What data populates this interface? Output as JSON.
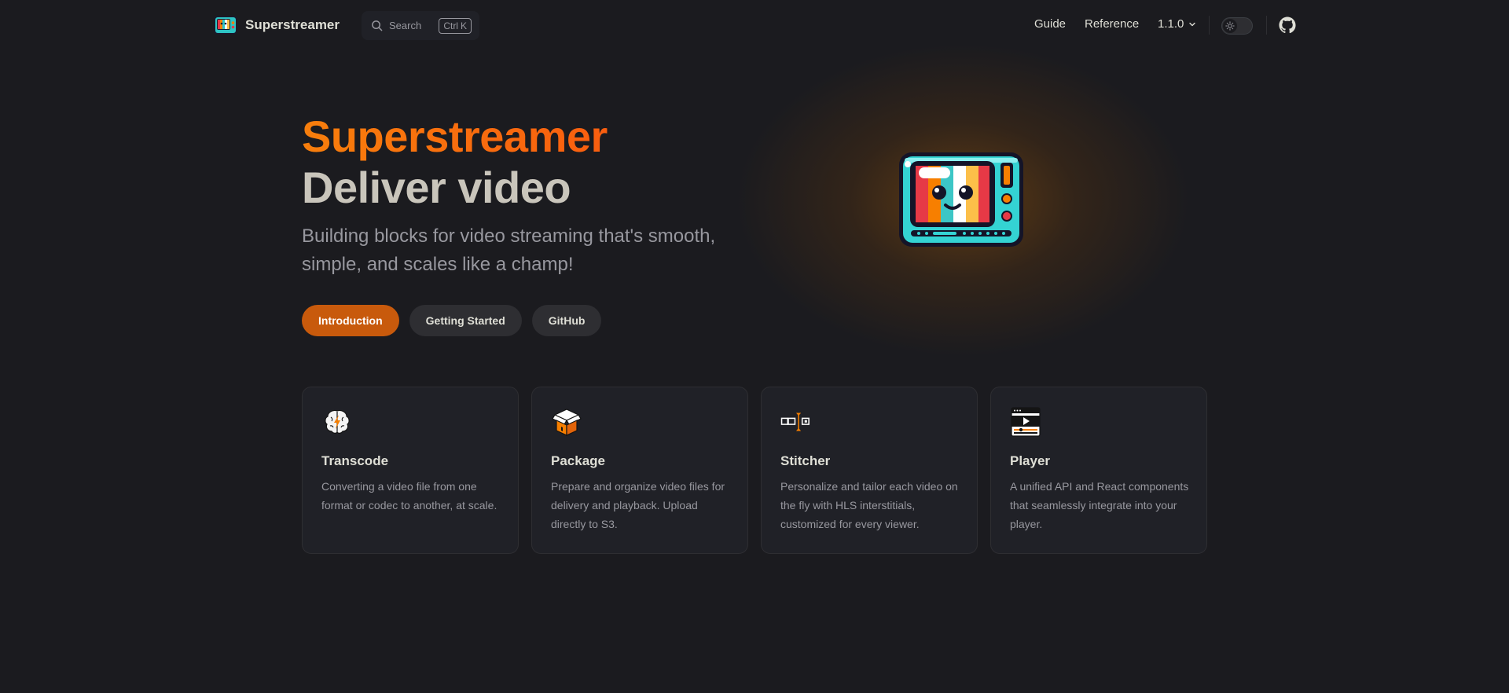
{
  "nav": {
    "brand_title": "Superstreamer",
    "search": {
      "label": "Search",
      "shortcut_mod": "Ctrl",
      "shortcut_key": "K"
    },
    "links": [
      {
        "label": "Guide"
      },
      {
        "label": "Reference"
      }
    ],
    "version": "1.1.0"
  },
  "hero": {
    "name": "Superstreamer",
    "text": "Deliver video",
    "tagline": "Building blocks for video streaming that's smooth, simple, and scales like a champ!",
    "actions": [
      {
        "label": "Introduction",
        "theme": "brand"
      },
      {
        "label": "Getting Started",
        "theme": "alt"
      },
      {
        "label": "GitHub",
        "theme": "alt"
      }
    ]
  },
  "features": [
    {
      "icon": "brain-icon",
      "title": "Transcode",
      "details": "Converting a video file from one format or codec to another, at scale."
    },
    {
      "icon": "package-icon",
      "title": "Package",
      "details": "Prepare and organize video files for delivery and playback. Upload directly to S3."
    },
    {
      "icon": "stitcher-icon",
      "title": "Stitcher",
      "details": "Personalize and tailor each video on the fly with HLS interstitials, customized for every viewer."
    },
    {
      "icon": "player-icon",
      "title": "Player",
      "details": "A unified API and React components that seamlessly integrate into your player."
    }
  ],
  "colors": {
    "background": "#1b1b1f",
    "brand": "#c85a0c",
    "accent_gradient_start": "#f77e0c",
    "accent_gradient_end": "#f95e0f",
    "card_bg": "#202127"
  }
}
